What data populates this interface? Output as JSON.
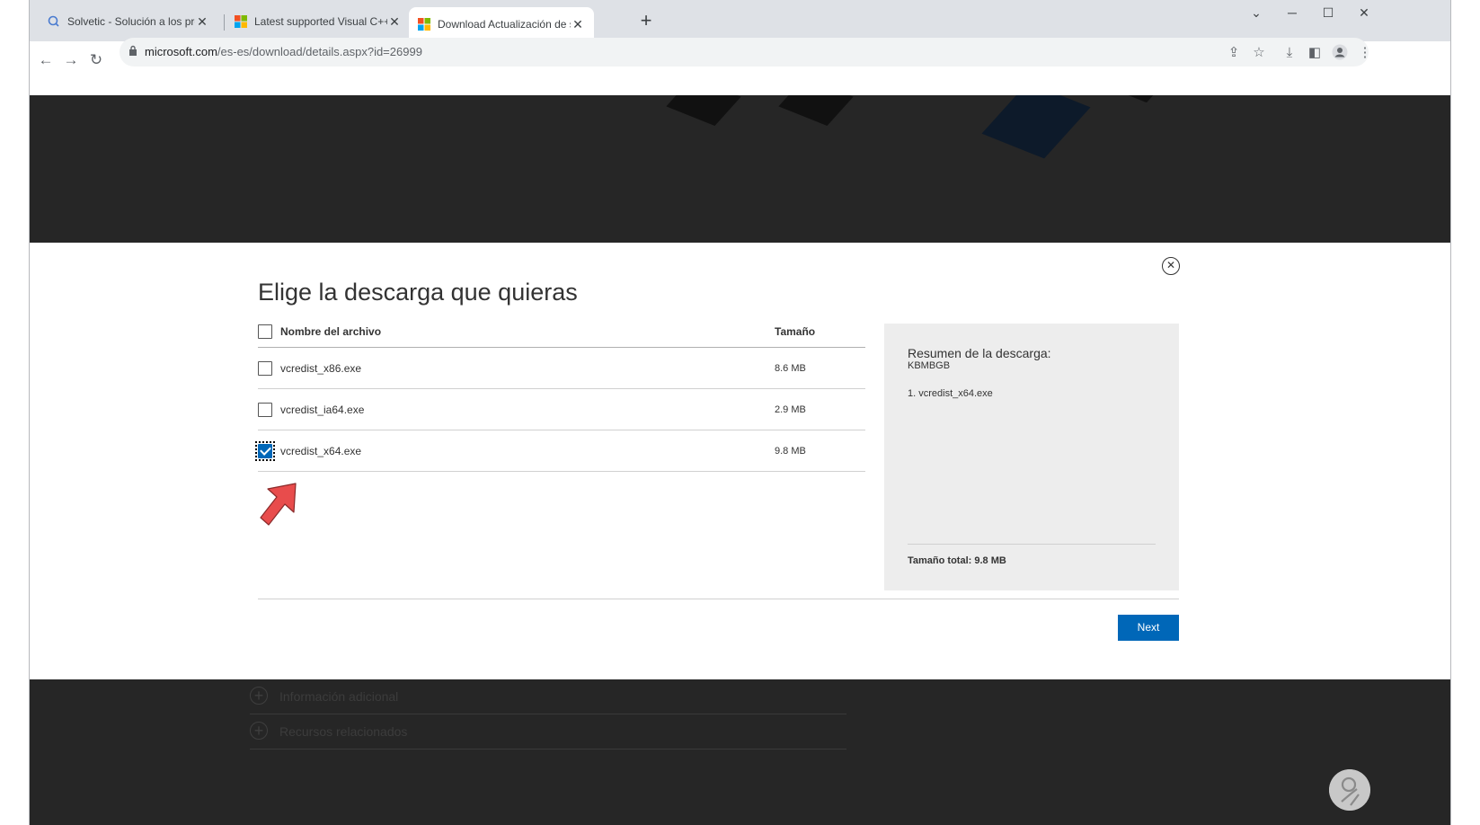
{
  "browser": {
    "tabs": [
      {
        "title": "Solvetic - Solución a los problem",
        "active": false,
        "icon": "solvetic-favicon"
      },
      {
        "title": "Latest supported Visual C++ Red",
        "active": false,
        "icon": "microsoft-favicon"
      },
      {
        "title": "Download Actualización de segu",
        "active": true,
        "icon": "microsoft-favicon"
      }
    ],
    "url_host": "microsoft.com",
    "url_path": "/es-es/download/details.aspx?id=26999"
  },
  "modal": {
    "title": "Elige la descarga que quieras",
    "table": {
      "col_name": "Nombre del archivo",
      "col_size": "Tamaño",
      "rows": [
        {
          "name": "vcredist_x86.exe",
          "size": "8.6 MB",
          "checked": false
        },
        {
          "name": "vcredist_ia64.exe",
          "size": "2.9 MB",
          "checked": false
        },
        {
          "name": "vcredist_x64.exe",
          "size": "9.8 MB",
          "checked": true
        }
      ]
    },
    "summary": {
      "title": "Resumen de la descarga:",
      "id": "KBMBGB",
      "item": "1. vcredist_x64.exe",
      "total": "Tamaño total: 9.8 MB"
    },
    "next_label": "Next"
  },
  "background": {
    "sections": [
      "Información adicional",
      "Recursos relacionados"
    ]
  },
  "colors": {
    "accent": "#0067b8",
    "arrow": "#e84c4c",
    "page_dark": "#262626"
  }
}
